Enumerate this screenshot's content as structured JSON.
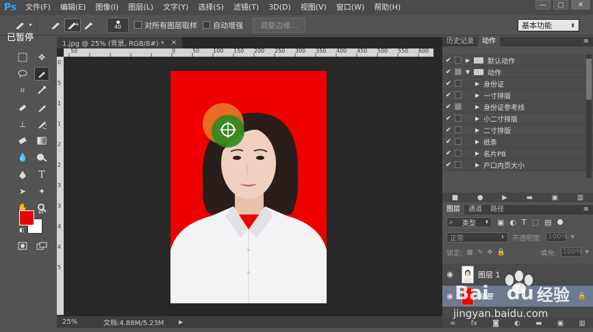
{
  "app": {
    "logo": "Ps"
  },
  "menu": [
    "文件(F)",
    "编辑(E)",
    "图像(I)",
    "图层(L)",
    "文字(Y)",
    "选择(S)",
    "滤镜(T)",
    "3D(D)",
    "视图(V)",
    "窗口(W)",
    "帮助(H)"
  ],
  "window": {
    "minimize": "—",
    "restore": "▢",
    "close": "✕"
  },
  "options": {
    "brush_size": "40",
    "sample_all": "对所有图层取样",
    "auto_enhance": "自动增强",
    "refine_edge": "调整边缘...",
    "workspace": "基本功能"
  },
  "overlay": {
    "paused": "已暂停"
  },
  "document": {
    "tab_title": "1.jpg @ 25% (背景, RGB/8#) *",
    "tab_close": "×",
    "zoom": "25%",
    "doc_size": "文档:4.88M/5.23M",
    "ruler_h": [
      "50",
      "0",
      "50",
      "100",
      "150",
      "200",
      "250",
      "300",
      "350",
      "400",
      "450",
      "500",
      "550",
      "600"
    ],
    "ruler_v": [
      "0",
      "5",
      "1",
      "1",
      "2",
      "2",
      "3",
      "3",
      "4",
      "4",
      "5"
    ]
  },
  "actions_panel": {
    "tabs": [
      "历史记录",
      "动作"
    ],
    "active_tab": "动作",
    "items": [
      {
        "label": "默认动作",
        "level": 0,
        "folder": true,
        "expanded": false
      },
      {
        "label": "动作",
        "level": 0,
        "folder": true,
        "expanded": true
      },
      {
        "label": "身份证",
        "level": 1
      },
      {
        "label": "一寸排版",
        "level": 1
      },
      {
        "label": "身份证参考线",
        "level": 1
      },
      {
        "label": "小二寸排版",
        "level": 1
      },
      {
        "label": "二寸排版",
        "level": 1
      },
      {
        "label": "纸条",
        "level": 1
      },
      {
        "label": "名片PB",
        "level": 1
      },
      {
        "label": "户口内页大小",
        "level": 1
      }
    ]
  },
  "layers_panel": {
    "tabs": [
      "图层",
      "通道",
      "路径"
    ],
    "active_tab": "图层",
    "filter": "类型",
    "blend_mode": "正常",
    "opacity_label": "不透明度:",
    "opacity": "100%",
    "lock_label": "锁定:",
    "fill_label": "填充:",
    "fill": "100%",
    "layers": [
      {
        "name": "图层 1",
        "thumb": "photo"
      },
      {
        "name": "背景",
        "thumb": "red",
        "selected": true,
        "locked": true
      }
    ]
  },
  "watermark": {
    "brand": "Bai",
    "brand2": "du",
    "suffix": "经验",
    "url": "jingyan.baidu.com"
  },
  "colors": {
    "foreground": "#ee0000",
    "background": "#ffffff",
    "canvas_bg": "#ee0000"
  }
}
